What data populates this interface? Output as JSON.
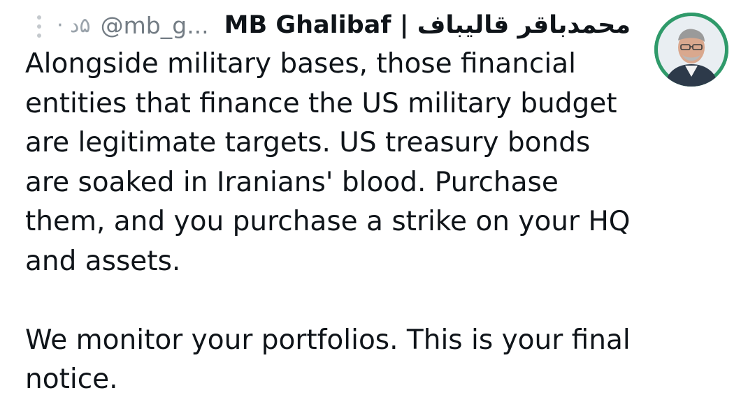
{
  "tweet": {
    "display_name_en": "MB Ghalibaf",
    "display_name_sep": " | ",
    "display_name_fa": "محمدباقر قالیباف",
    "handle": "@mb_g...",
    "separator": "·",
    "timestamp": "۵د",
    "body_paragraph_1": "Alongside military bases, those financial entities that finance the US military budget are legitimate targets. US treasury bonds are soaked in Iranians' blood. Purchase them, and you purchase a strike on your HQ and assets.",
    "body_paragraph_2": "We monitor your portfolios. This is your final notice."
  },
  "icons": {
    "more": "more-vertical-icon",
    "avatar": "profile-photo"
  },
  "colors": {
    "text": "#0f1419",
    "secondary": "#737c84",
    "muted": "#9aa3ab",
    "avatar_ring": "#2f9a6a"
  }
}
